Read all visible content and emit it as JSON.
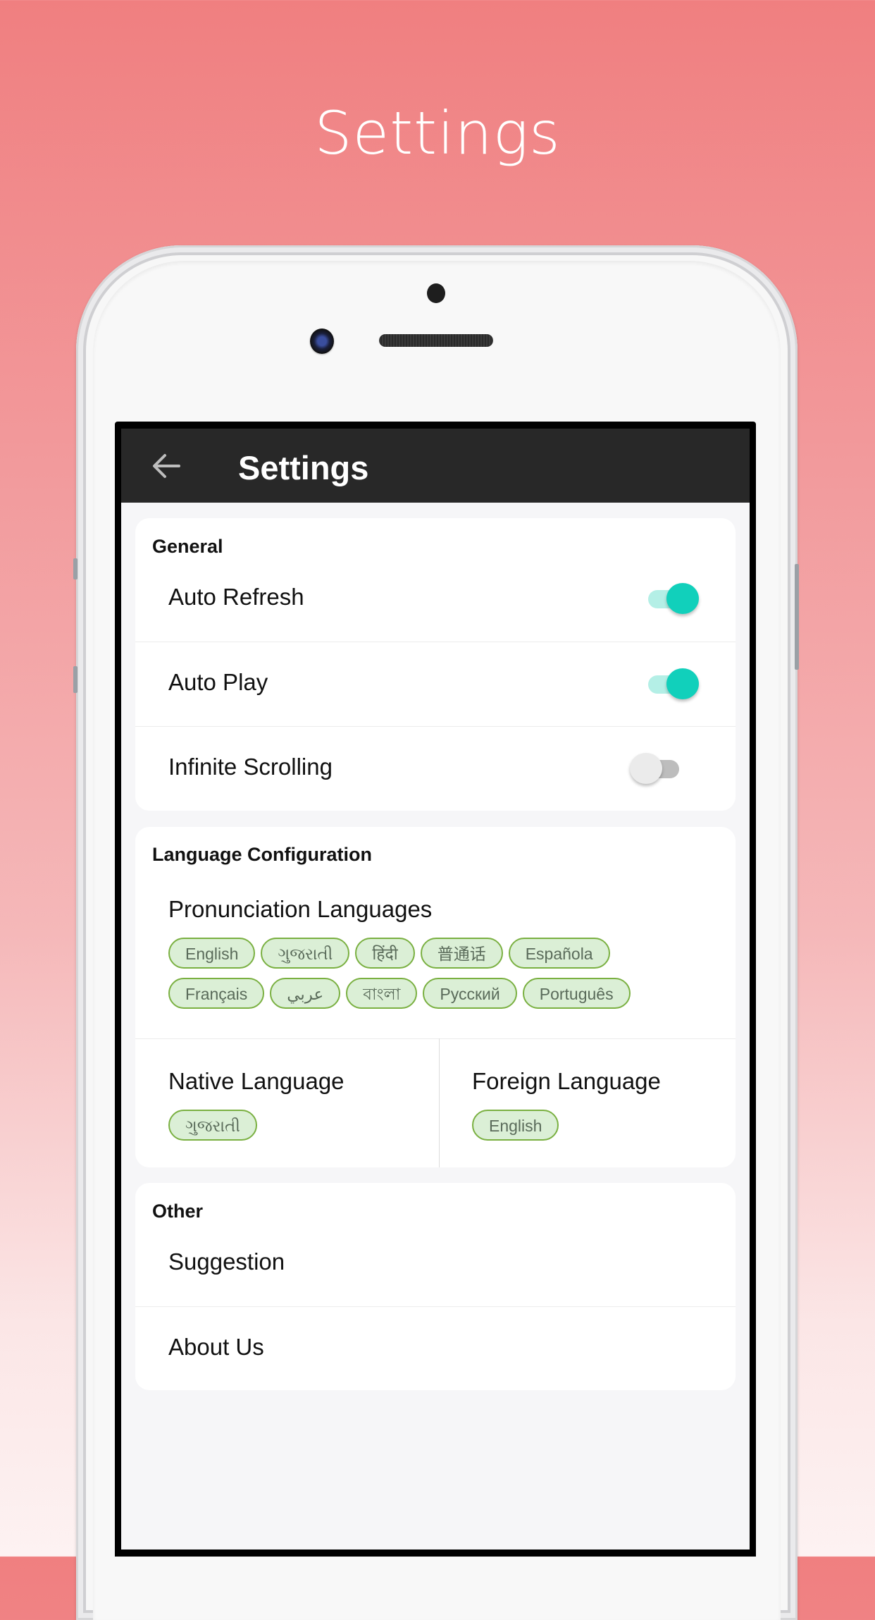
{
  "hero": {
    "title": "Settings"
  },
  "appbar": {
    "title": "Settings",
    "back_icon": "arrow-left-icon"
  },
  "colors": {
    "accent_toggle_on": "#11d0bb",
    "toggle_track_on": "#b4efe6",
    "toggle_off_thumb": "#ebebeb",
    "toggle_off_track": "#bdbdbd",
    "chip_bg": "#dbefd6",
    "chip_border": "#7ab041",
    "appbar_bg": "#282828"
  },
  "general": {
    "header": "General",
    "items": [
      {
        "label": "Auto Refresh",
        "enabled": true
      },
      {
        "label": "Auto Play",
        "enabled": true
      },
      {
        "label": "Infinite Scrolling",
        "enabled": false
      }
    ]
  },
  "language": {
    "header": "Language Configuration",
    "pronunciation": {
      "label": "Pronunciation Languages",
      "chips": [
        "English",
        "ગુજરાતી",
        "हिंदी",
        "普通话",
        "Española",
        "Français",
        "عربي",
        "বাংলা",
        "Русский",
        "Português"
      ]
    },
    "native": {
      "label": "Native Language",
      "value": "ગુજરાતી"
    },
    "foreign": {
      "label": "Foreign Language",
      "value": "English"
    }
  },
  "other": {
    "header": "Other",
    "items": [
      {
        "label": "Suggestion"
      },
      {
        "label": "About Us"
      }
    ]
  }
}
